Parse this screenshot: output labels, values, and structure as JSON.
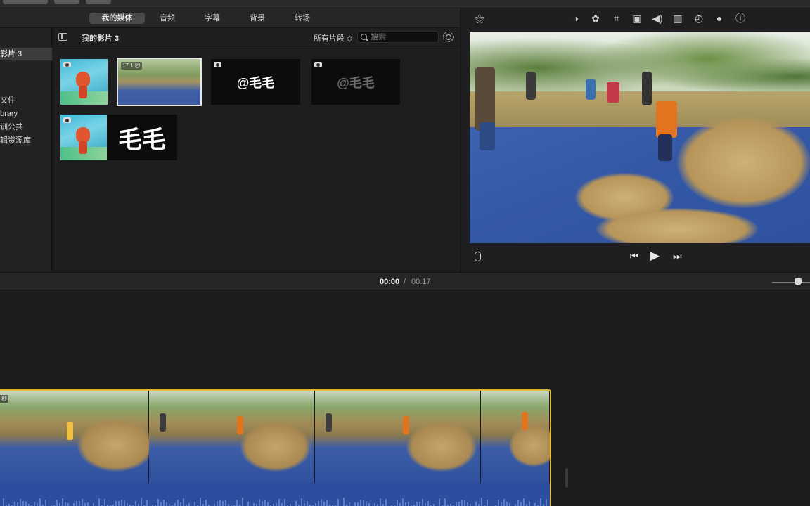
{
  "tabs": [
    "我的媒体",
    "音频",
    "字幕",
    "背景",
    "转场"
  ],
  "sidebar": {
    "items": [
      "影片 3",
      "文件",
      "brary",
      "训公共",
      "辑资源库"
    ]
  },
  "library": {
    "title": "我的影片 3",
    "filter": "所有片段 ◇",
    "search_placeholder": "搜索"
  },
  "clips": [
    {
      "type": "photo"
    },
    {
      "type": "video",
      "duration": "17.1 秒"
    },
    {
      "type": "photo-text",
      "text": "@毛毛"
    },
    {
      "type": "photo-text",
      "text": "@毛毛"
    },
    {
      "type": "photo"
    },
    {
      "type": "text",
      "text": "毛毛"
    }
  ],
  "viewer": {
    "tools": [
      "magic-wand-icon",
      "color-balance-icon",
      "color-palette-icon",
      "crop-icon",
      "stabilization-icon",
      "volume-icon",
      "equalizer-icon",
      "speed-icon",
      "filter-icon",
      "info-icon"
    ]
  },
  "timecode": {
    "current": "00:00",
    "separator": "/",
    "total": "00:17"
  },
  "timeline": {
    "clip_duration_label": "秒"
  },
  "colors": {
    "selection": "#e3b93a",
    "audio": "#2b4f9e"
  }
}
